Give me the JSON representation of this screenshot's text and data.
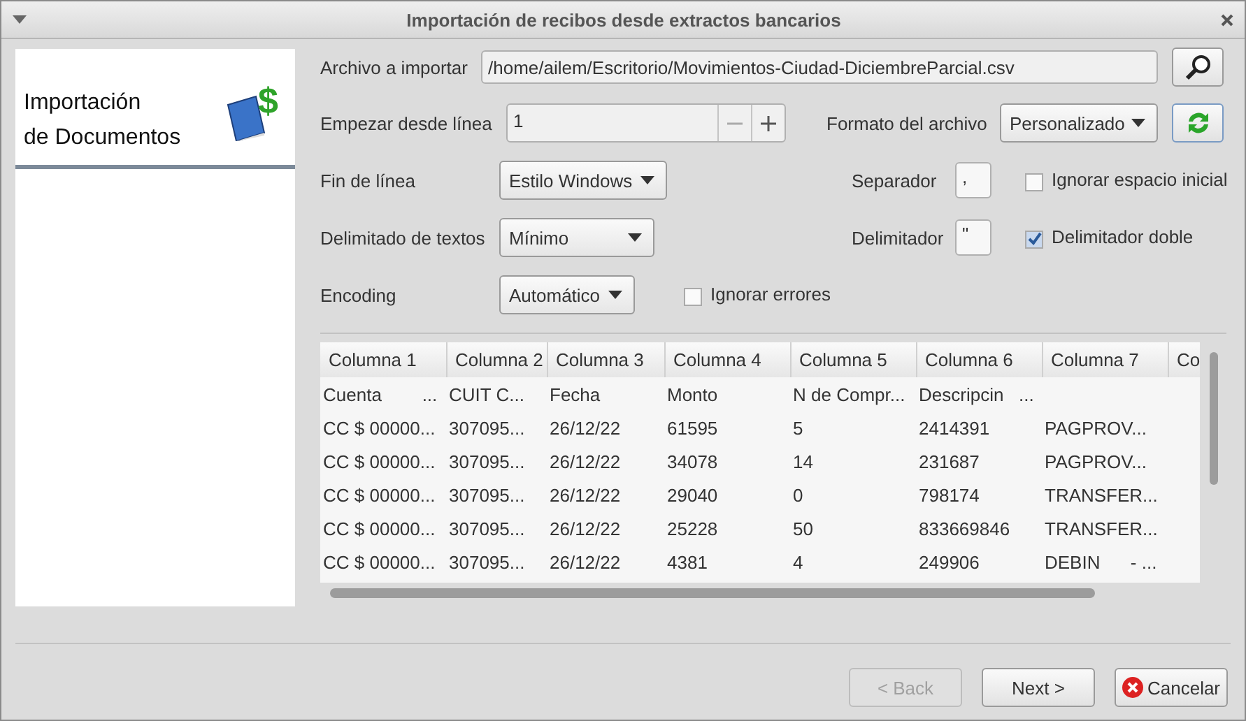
{
  "window": {
    "title": "Importación de recibos desde extractos bancarios"
  },
  "sidebar": {
    "title": "Importación\nde Documentos",
    "badge": "$"
  },
  "file": {
    "label": "Archivo a importar",
    "value": "/home/ailem/Escritorio/Movimientos-Ciudad-DiciembreParcial.csv"
  },
  "start_line": {
    "label": "Empezar desde línea",
    "value": "1"
  },
  "file_format": {
    "label": "Formato del archivo",
    "value": "Personalizado"
  },
  "line_ending": {
    "label": "Fin de línea",
    "value": "Estilo Windows"
  },
  "separator": {
    "label": "Separador",
    "value": ","
  },
  "ignore_leading_space": {
    "label": "Ignorar espacio inicial",
    "checked": false
  },
  "text_delimiting": {
    "label": "Delimitado de textos",
    "value": "Mínimo"
  },
  "delimiter": {
    "label": "Delimitador",
    "value": "\""
  },
  "double_delimiter": {
    "label": "Delimitador doble",
    "checked": true
  },
  "encoding": {
    "label": "Encoding",
    "value": "Automático"
  },
  "ignore_errors": {
    "label": "Ignorar errores",
    "checked": false
  },
  "table": {
    "columns": [
      "Columna 1",
      "Columna 2",
      "Columna 3",
      "Columna 4",
      "Columna 5",
      "Columna 6",
      "Columna 7",
      "Co"
    ],
    "rows": [
      [
        "Cuenta        ...",
        "CUIT C...",
        "Fecha",
        "Monto",
        "N de Compr...",
        "Descripcin   ..."
      ],
      [
        "CC $ 00000...",
        "307095...",
        "26/12/22",
        "61595",
        "5",
        "2414391",
        "PAGPROV..."
      ],
      [
        "CC $ 00000...",
        "307095...",
        "26/12/22",
        "34078",
        "14",
        "231687",
        "PAGPROV..."
      ],
      [
        "CC $ 00000...",
        "307095...",
        "26/12/22",
        "29040",
        "0",
        "798174",
        "TRANSFER..."
      ],
      [
        "CC $ 00000...",
        "307095...",
        "26/12/22",
        "25228",
        "50",
        "833669846",
        "TRANSFER..."
      ],
      [
        "CC $ 00000...",
        "307095...",
        "26/12/22",
        "4381",
        "4",
        "249906",
        "DEBIN      - ..."
      ]
    ]
  },
  "buttons": [
    {
      "label": "< Back",
      "kind": "back",
      "disabled": true
    },
    {
      "label": "Next >",
      "kind": "next",
      "disabled": false
    },
    {
      "label": "Cancelar",
      "kind": "cancel",
      "disabled": false
    }
  ]
}
